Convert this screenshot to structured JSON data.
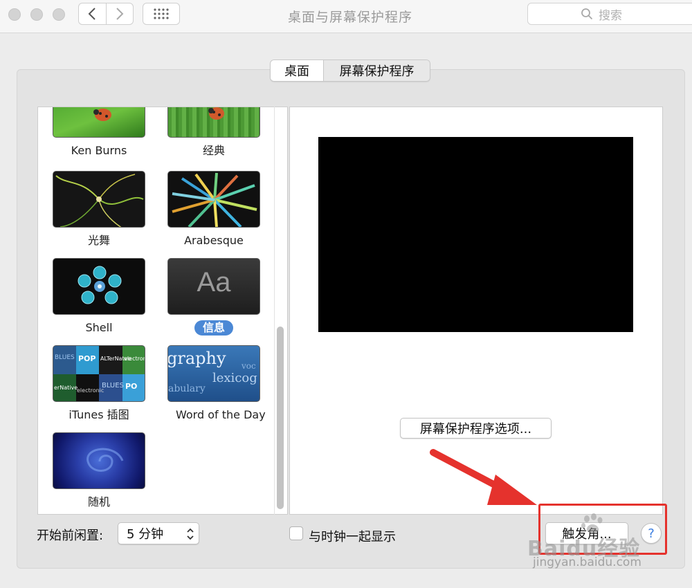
{
  "window": {
    "title": "桌面与屏幕保护程序"
  },
  "toolbar": {
    "back_icon": "chevron-left-icon",
    "forward_icon": "chevron-right-icon",
    "show_all_icon": "grid-icon"
  },
  "search": {
    "placeholder": "搜索"
  },
  "tabs": [
    {
      "label": "桌面",
      "selected": false
    },
    {
      "label": "屏幕保护程序",
      "selected": true
    }
  ],
  "screensavers": [
    {
      "label": "Ken Burns",
      "selected": false
    },
    {
      "label": "经典",
      "selected": false
    },
    {
      "label": "光舞",
      "selected": false
    },
    {
      "label": "Arabesque",
      "selected": false
    },
    {
      "label": "Shell",
      "selected": false
    },
    {
      "label": "信息",
      "selected": true
    },
    {
      "label": "iTunes 插图",
      "selected": false
    },
    {
      "label": "Word of the Day",
      "selected": false
    },
    {
      "label": "随机",
      "selected": false
    }
  ],
  "thumbnails": {
    "info": "Aa",
    "itunes": [
      "BLUES",
      "POP",
      "ALTerNatve",
      "electronic",
      "erNative",
      "electronic",
      "BLUES",
      "PO"
    ],
    "word_of_day": [
      "graphy",
      "voc",
      "lexicog",
      "abulary"
    ]
  },
  "preview": {
    "options_button": "屏幕保护程序选项..."
  },
  "bottom": {
    "idle_label": "开始前闲置:",
    "idle_value": "5 分钟",
    "clock_checkbox": "与时钟一起显示",
    "clock_checked": false,
    "hot_corners_button": "触发角...",
    "help_button": "?"
  },
  "annotation": {
    "color": "#e5322d"
  },
  "watermark": {
    "text": "Baidu经验",
    "url": "jingyan.baidu.com"
  }
}
